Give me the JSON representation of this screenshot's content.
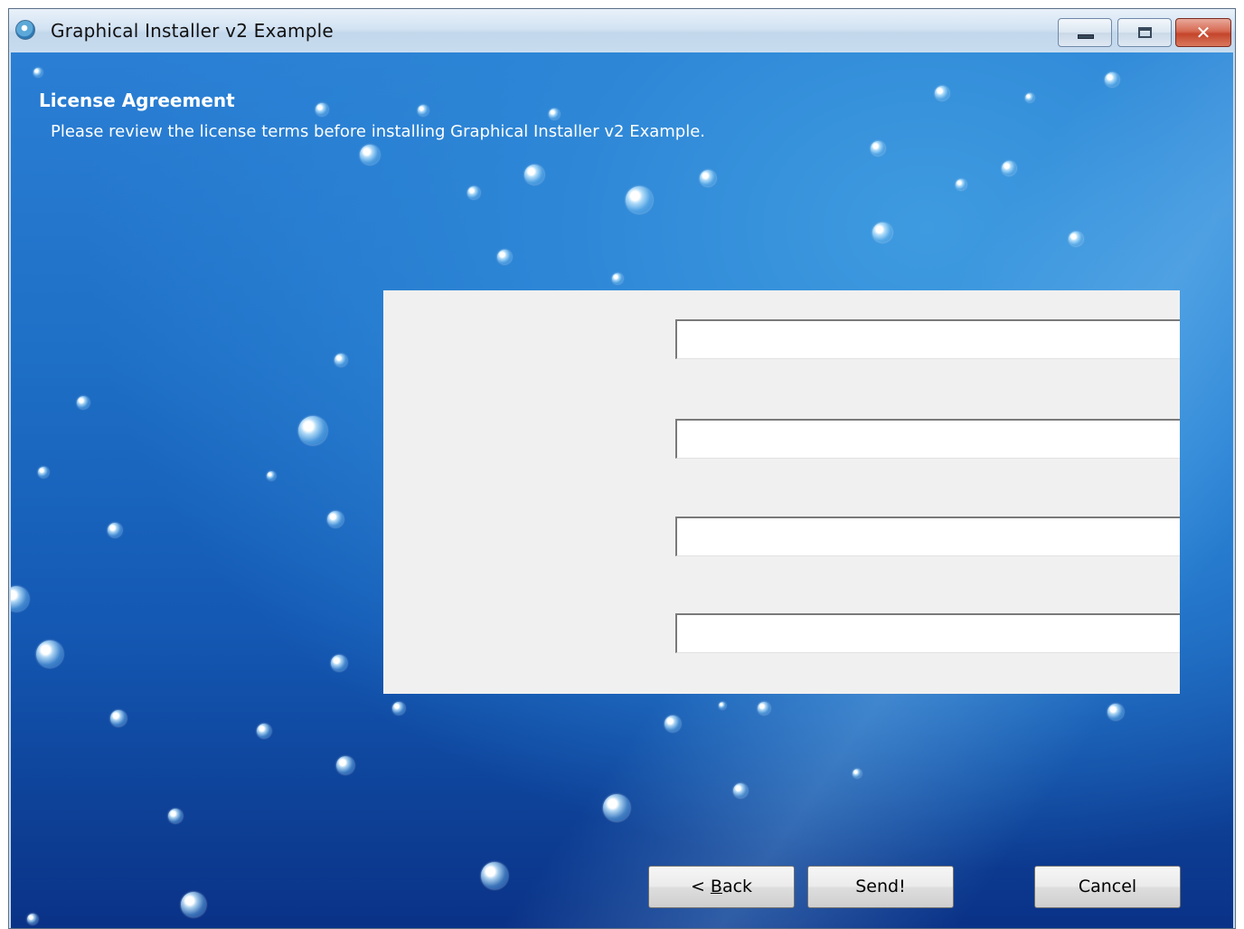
{
  "window": {
    "title": "Graphical Installer v2 Example",
    "app_icon": "installer-app-icon",
    "controls": {
      "minimize_icon": "minimize-icon",
      "maximize_icon": "maximize-icon",
      "close_icon": "close-icon",
      "close_glyph": "✕"
    }
  },
  "page": {
    "heading": "License Agreement",
    "subheading": "Please review the license terms before installing Graphical Installer v2 Example."
  },
  "form": {
    "fields": [
      {
        "value": "",
        "placeholder": ""
      },
      {
        "value": "",
        "placeholder": ""
      },
      {
        "value": "",
        "placeholder": ""
      },
      {
        "value": "",
        "placeholder": ""
      }
    ]
  },
  "buttons": {
    "back_prefix": "< ",
    "back_mnemonic": "B",
    "back_rest": "ack",
    "send": "Send!",
    "cancel": "Cancel"
  },
  "colors": {
    "background_top": "#2a7fd4",
    "background_bottom": "#0a3287",
    "panel": "#f0f0f0",
    "close_button": "#c4452b",
    "text_on_background": "#ffffff"
  }
}
